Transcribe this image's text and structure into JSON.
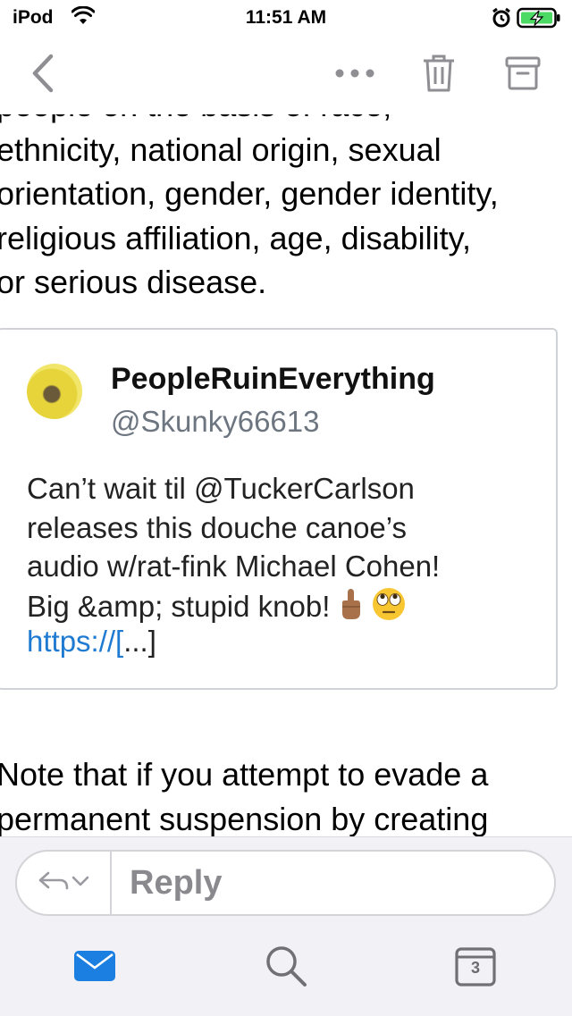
{
  "status_bar": {
    "carrier": "iPod",
    "time": "11:51 AM",
    "icons": [
      "wifi-icon",
      "alarm-icon",
      "battery-charging-icon"
    ],
    "battery_color": "#4cd964"
  },
  "toolbar": {
    "icons": [
      "back-chevron-icon",
      "more-icon",
      "trash-icon",
      "archive-icon"
    ],
    "icon_color": "#8e8e93"
  },
  "message": {
    "top_lines": [
      "people on the basis of race,",
      "ethnicity, national origin, sexual",
      "orientation, gender, gender identity,",
      "religious affiliation, age, disability,",
      "or serious disease."
    ],
    "bottom_lines": [
      "Note that if you attempt to evade a",
      "permanent suspension by creating"
    ]
  },
  "tweet": {
    "name": "PeopleRuinEverything",
    "handle": "@Skunky66613",
    "text": "Can’t wait til @TuckerCarlson\nreleases this douche canoe’s\naudio w/rat-fink Michael Cohen!\nBig &amp; stupid knob!",
    "emojis": [
      "middle-finger-emoji",
      "eye-roll-emoji"
    ],
    "link": "https://[",
    "link_suffix": "...]",
    "link_color": "#1f7ad1"
  },
  "reply_bar": {
    "label": "Reply",
    "icons": [
      "reply-arrow-icon",
      "chevron-down-icon"
    ]
  },
  "tab_bar": {
    "icons": [
      "mail-icon",
      "search-icon",
      "calendar-icon"
    ],
    "calendar_day": "3",
    "accent": "#1a7fe0"
  }
}
